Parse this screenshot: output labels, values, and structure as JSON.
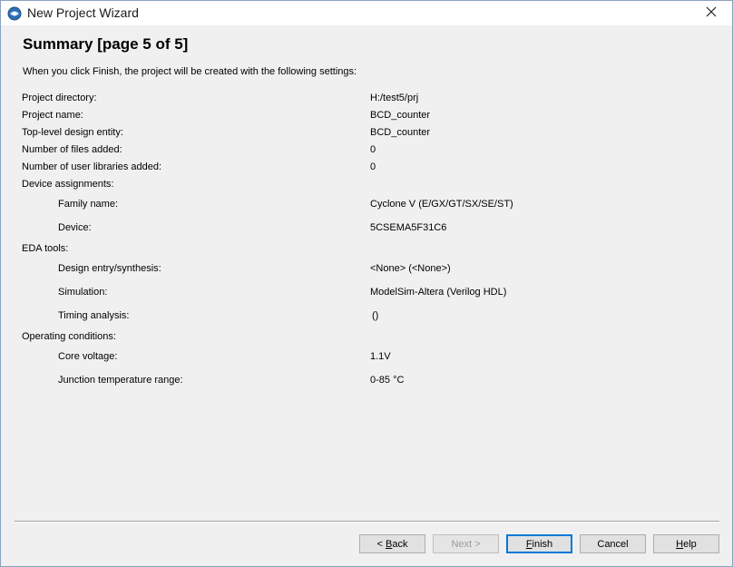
{
  "window": {
    "title": "New Project Wizard"
  },
  "page": {
    "heading": "Summary [page 5 of 5]",
    "intro": "When you click Finish, the project will be created with the following settings:"
  },
  "settings": {
    "project_directory": {
      "label": "Project directory:",
      "value": "H:/test5/prj"
    },
    "project_name": {
      "label": "Project name:",
      "value": "BCD_counter"
    },
    "top_level_entity": {
      "label": "Top-level design entity:",
      "value": "BCD_counter"
    },
    "files_added": {
      "label": "Number of files added:",
      "value": "0"
    },
    "user_libraries": {
      "label": "Number of user libraries added:",
      "value": "0"
    },
    "device_assignments": {
      "label": "Device assignments:"
    },
    "family_name": {
      "label": "Family name:",
      "value": "Cyclone V (E/GX/GT/SX/SE/ST)"
    },
    "device": {
      "label": "Device:",
      "value": "5CSEMA5F31C6"
    },
    "eda_tools": {
      "label": "EDA tools:"
    },
    "design_entry": {
      "label": "Design entry/synthesis:",
      "value": "<None> (<None>)"
    },
    "simulation": {
      "label": "Simulation:",
      "value": "ModelSim-Altera (Verilog HDL)"
    },
    "timing_analysis": {
      "label": "Timing analysis:",
      "value": "()"
    },
    "operating_conditions": {
      "label": "Operating conditions:"
    },
    "core_voltage": {
      "label": "Core voltage:",
      "value": "1.1V"
    },
    "junction_temp": {
      "label": "Junction temperature range:",
      "value": "0-85 °C"
    }
  },
  "buttons": {
    "back": {
      "prefix": "< ",
      "accel": "B",
      "rest": "ack"
    },
    "next": {
      "label": "Next >"
    },
    "finish": {
      "accel": "F",
      "rest": "inish"
    },
    "cancel": {
      "label": "Cancel"
    },
    "help": {
      "accel": "H",
      "rest": "elp"
    }
  },
  "colors": {
    "accent": "#0078d7",
    "window_bg": "#f0f0f0"
  }
}
